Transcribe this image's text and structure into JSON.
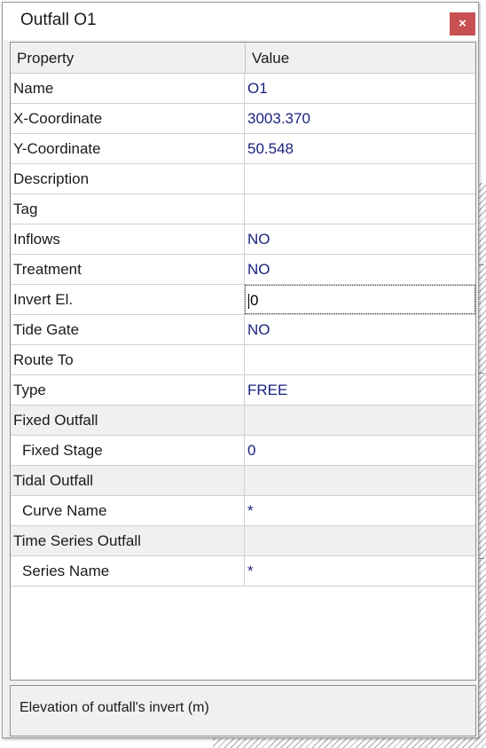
{
  "window": {
    "title": "Outfall O1",
    "close_label": "×"
  },
  "grid": {
    "header": {
      "property": "Property",
      "value": "Value"
    },
    "rows": [
      {
        "label": "Name",
        "value": "O1"
      },
      {
        "label": "X-Coordinate",
        "value": "3003.370"
      },
      {
        "label": "Y-Coordinate",
        "value": "50.548"
      },
      {
        "label": "Description",
        "value": ""
      },
      {
        "label": "Tag",
        "value": ""
      },
      {
        "label": "Inflows",
        "value": "NO"
      },
      {
        "label": "Treatment",
        "value": "NO"
      },
      {
        "label": "Invert El.",
        "value": "0"
      },
      {
        "label": "Tide Gate",
        "value": "NO"
      },
      {
        "label": "Route To",
        "value": ""
      },
      {
        "label": "Type",
        "value": "FREE"
      },
      {
        "label": "Fixed Outfall",
        "value": ""
      },
      {
        "label": "Fixed Stage",
        "value": "0"
      },
      {
        "label": "Tidal Outfall",
        "value": ""
      },
      {
        "label": "Curve Name",
        "value": "*"
      },
      {
        "label": "Time Series Outfall",
        "value": ""
      },
      {
        "label": "Series Name",
        "value": "*"
      }
    ]
  },
  "status": {
    "description": "Elevation of outfall's invert (m)"
  },
  "colors": {
    "value_text": "#1a237e",
    "close_button": "#c75050",
    "category_row": "#f0f0f0"
  }
}
